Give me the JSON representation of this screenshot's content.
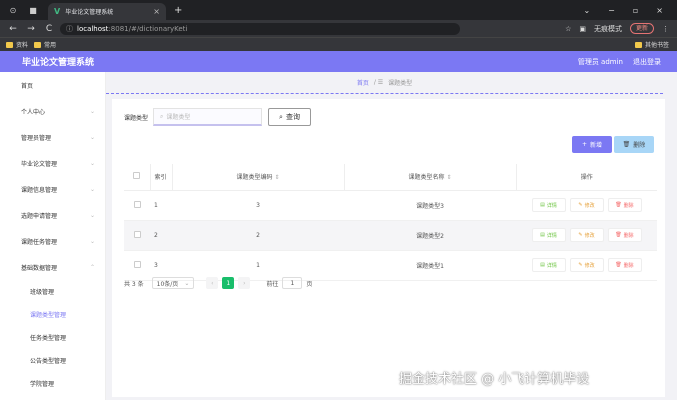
{
  "browser": {
    "tab_title": "毕业论文管理系统",
    "url_host": "localhost",
    "url_path": ":8081/#/dictionaryKeti",
    "incognito_label": "无痕模式",
    "update_label": "更新",
    "bookmarks": [
      "资料",
      "常用"
    ],
    "bookmarks_right": "其他书签"
  },
  "header": {
    "title": "毕业论文管理系统",
    "user_label": "管理员 admin",
    "logout_label": "退出登录"
  },
  "sidebar": {
    "items": [
      {
        "label": "首页"
      },
      {
        "label": "个人中心"
      },
      {
        "label": "管理员管理"
      },
      {
        "label": "毕业论文管理"
      },
      {
        "label": "课题信息管理"
      },
      {
        "label": "选题申请管理"
      },
      {
        "label": "课题任务管理"
      },
      {
        "label": "基础数据管理"
      }
    ],
    "sub_items": [
      {
        "label": "班级管理"
      },
      {
        "label": "课题类型管理"
      },
      {
        "label": "任务类型管理"
      },
      {
        "label": "公告类型管理"
      },
      {
        "label": "学院管理"
      }
    ]
  },
  "breadcrumb": {
    "home": "首页",
    "current": "课题类型"
  },
  "search": {
    "label": "课题类型",
    "placeholder": "课题类型",
    "button_label": "查询"
  },
  "toolbar": {
    "add_label": "新增",
    "delete_label": "删除"
  },
  "table": {
    "headers": {
      "index": "索引",
      "code": "课题类型编码",
      "name": "课题类型名称",
      "actions": "操作"
    },
    "rows": [
      {
        "index": "1",
        "code": "3",
        "name": "课题类型3"
      },
      {
        "index": "2",
        "code": "2",
        "name": "课题类型2"
      },
      {
        "index": "3",
        "code": "1",
        "name": "课题类型1"
      }
    ],
    "action_labels": {
      "detail": "详情",
      "edit": "修改",
      "delete": "删除"
    }
  },
  "pagination": {
    "total": "共 3 条",
    "page_size": "10条/页",
    "current_page": "1",
    "goto_label": "前往",
    "goto_value": "1",
    "page_suffix": "页"
  },
  "watermark": "掘金技术社区 @ 小飞计算机毕设",
  "colors": {
    "primary": "#7b78f3",
    "success": "#19be6b",
    "info_button": "#a8d6f7"
  }
}
